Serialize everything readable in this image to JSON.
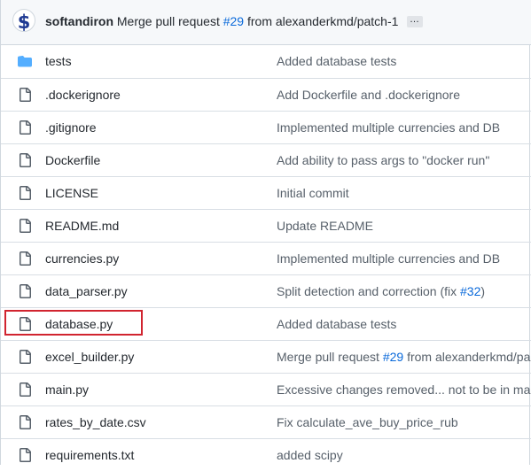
{
  "latest_commit": {
    "author": "softandiron",
    "message_prefix": "Merge pull request",
    "pr_link": "#29",
    "message_suffix": "from alexanderkmd/patch-1",
    "ellipsis": "…"
  },
  "files": [
    {
      "name": "tests",
      "type": "folder",
      "msg_prefix": "Added database tests",
      "msg_link": "",
      "msg_suffix": ""
    },
    {
      "name": ".dockerignore",
      "type": "file",
      "msg_prefix": "Add Dockerfile and .dockerignore",
      "msg_link": "",
      "msg_suffix": ""
    },
    {
      "name": ".gitignore",
      "type": "file",
      "msg_prefix": "Implemented multiple currencies and DB",
      "msg_link": "",
      "msg_suffix": ""
    },
    {
      "name": "Dockerfile",
      "type": "file",
      "msg_prefix": "Add ability to pass args to \"docker run\"",
      "msg_link": "",
      "msg_suffix": ""
    },
    {
      "name": "LICENSE",
      "type": "file",
      "msg_prefix": "Initial commit",
      "msg_link": "",
      "msg_suffix": ""
    },
    {
      "name": "README.md",
      "type": "file",
      "msg_prefix": "Update README",
      "msg_link": "",
      "msg_suffix": ""
    },
    {
      "name": "currencies.py",
      "type": "file",
      "msg_prefix": "Implemented multiple currencies and DB",
      "msg_link": "",
      "msg_suffix": ""
    },
    {
      "name": "data_parser.py",
      "type": "file",
      "msg_prefix": "Split detection and correction (fix ",
      "msg_link": "#32",
      "msg_suffix": ")"
    },
    {
      "name": "database.py",
      "type": "file",
      "msg_prefix": "Added database tests",
      "msg_link": "",
      "msg_suffix": ""
    },
    {
      "name": "excel_builder.py",
      "type": "file",
      "msg_prefix": "Merge pull request ",
      "msg_link": "#29",
      "msg_suffix": " from alexanderkmd/pa"
    },
    {
      "name": "main.py",
      "type": "file",
      "msg_prefix": "Excessive changes removed... not to be in main",
      "msg_link": "",
      "msg_suffix": ""
    },
    {
      "name": "rates_by_date.csv",
      "type": "file",
      "msg_prefix": "Fix calculate_ave_buy_price_rub",
      "msg_link": "",
      "msg_suffix": ""
    },
    {
      "name": "requirements.txt",
      "type": "file",
      "msg_prefix": "added scipy",
      "msg_link": "",
      "msg_suffix": ""
    }
  ],
  "highlighted_file": "database.py",
  "colors": {
    "link": "#0969da",
    "folder": "#54aeff",
    "highlight": "#d1242f"
  }
}
